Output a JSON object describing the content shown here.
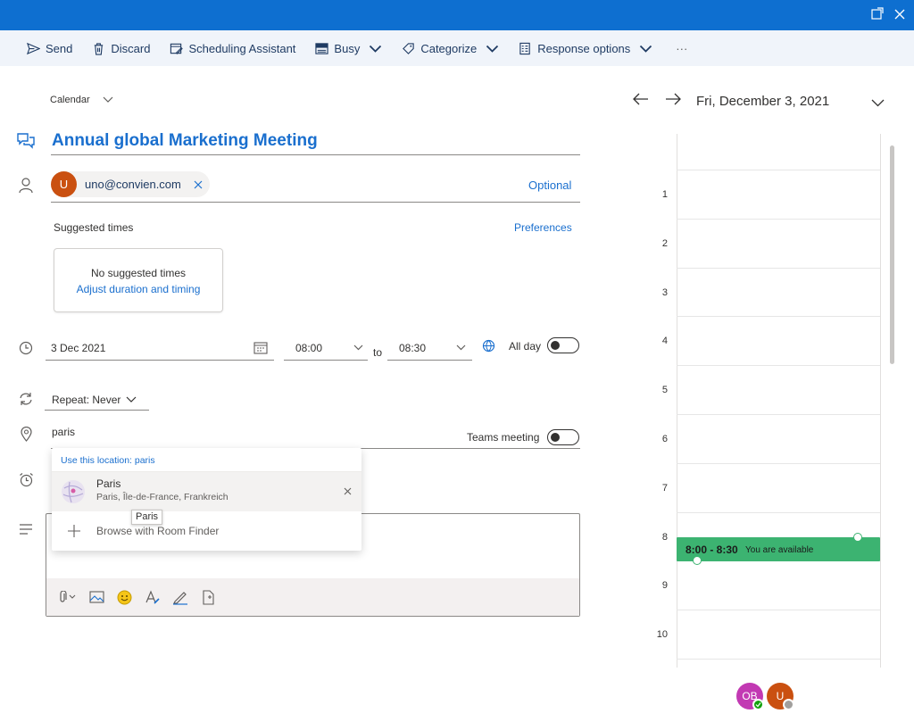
{
  "toolbar": {
    "send": "Send",
    "discard": "Discard",
    "scheduling": "Scheduling Assistant",
    "busy": "Busy",
    "categorize": "Categorize",
    "response": "Response options",
    "more": "···"
  },
  "form": {
    "calendar_label": "Calendar",
    "title": "Annual global Marketing Meeting",
    "attendee": {
      "initial": "U",
      "email": "uno@convien.com"
    },
    "optional": "Optional",
    "suggested_times": "Suggested times",
    "preferences": "Preferences",
    "no_suggested": "No suggested times",
    "adjust": "Adjust duration and timing",
    "date": "3 Dec 2021",
    "start_time": "08:00",
    "to": "to",
    "end_time": "08:30",
    "all_day": "All day",
    "repeat": "Repeat: Never",
    "location": "paris",
    "teams": "Teams meeting"
  },
  "location_dropdown": {
    "use_this": "Use this location: paris",
    "result_name": "Paris",
    "result_detail": "Paris, Île-de-France, Frankreich",
    "browse": "Browse with Room Finder",
    "tooltip": "Paris"
  },
  "calendar": {
    "date": "Fri, December 3, 2021",
    "hours": [
      "1",
      "2",
      "3",
      "4",
      "5",
      "6",
      "7",
      "8",
      "9",
      "10"
    ],
    "event_time": "8:00 - 8:30",
    "event_status": "You are available"
  },
  "avatars": [
    {
      "initials": "OB",
      "color": "#c239b3"
    },
    {
      "initials": "U",
      "color": "#ca5010"
    }
  ],
  "colors": {
    "accent": "#0e6fd0",
    "available": "#3cb371"
  }
}
